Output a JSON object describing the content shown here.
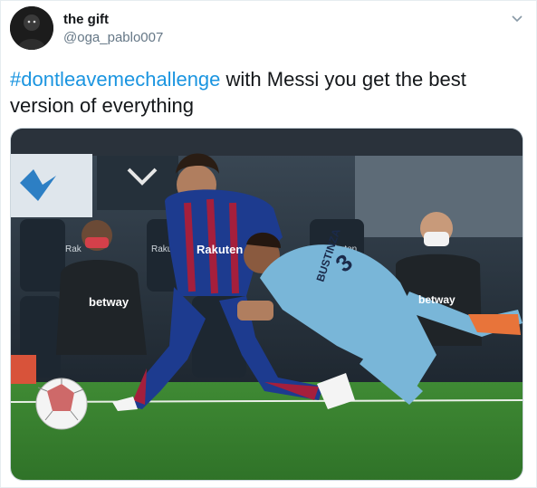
{
  "tweet": {
    "display_name": "the gift",
    "handle": "@oga_pablo007",
    "hashtag": "#dontleavemechallenge",
    "text_line1_rest": " with Messi you get the best",
    "text_line2": "version of everything"
  },
  "icons": {
    "menu": "chevron-down-icon"
  },
  "media": {
    "ad_board_1": "Rakuten",
    "ad_board_2": "Rakuten",
    "ad_board_3": "Rak",
    "shirt_sponsor_1": "Rakuten",
    "shirt_sponsor_2": "betway",
    "shirt_sponsor_3": "betway",
    "jersey_name": "BUSTINZA",
    "jersey_number": "3"
  },
  "colors": {
    "hashtag": "#1b95e0",
    "handle": "#657786",
    "border": "#e6ecf0"
  }
}
